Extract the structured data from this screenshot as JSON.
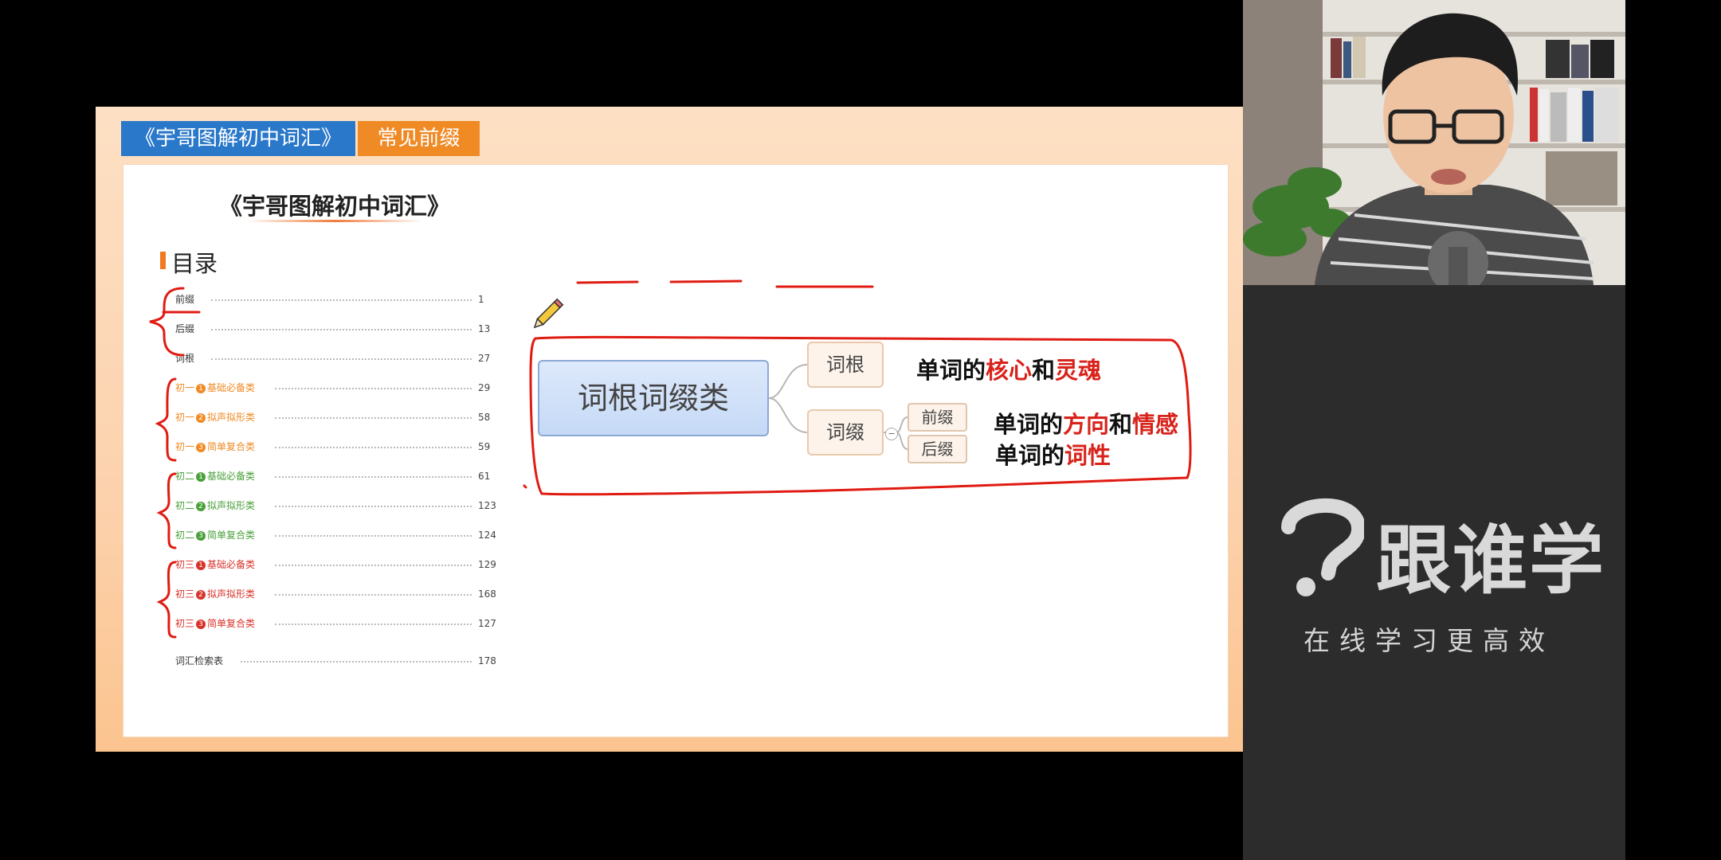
{
  "slide": {
    "tab_book": "《宇哥图解初中词汇》",
    "tab_topic": "常见前缀",
    "book_title": "《宇哥图解初中词汇》",
    "toc_heading": "目录",
    "toc": [
      {
        "label": "前缀",
        "page": "1",
        "color": "black"
      },
      {
        "label": "后缀",
        "page": "13",
        "color": "black"
      },
      {
        "label": "词根",
        "page": "27",
        "color": "black"
      },
      {
        "grade": "初一",
        "num": "1",
        "label": "基础必备类",
        "page": "29",
        "color": "orange"
      },
      {
        "grade": "初一",
        "num": "2",
        "label": "拟声拟形类",
        "page": "58",
        "color": "orange"
      },
      {
        "grade": "初一",
        "num": "3",
        "label": "简单复合类",
        "page": "59",
        "color": "orange"
      },
      {
        "grade": "初二",
        "num": "1",
        "label": "基础必备类",
        "page": "61",
        "color": "green"
      },
      {
        "grade": "初二",
        "num": "2",
        "label": "拟声拟形类",
        "page": "123",
        "color": "green"
      },
      {
        "grade": "初二",
        "num": "3",
        "label": "简单复合类",
        "page": "124",
        "color": "green"
      },
      {
        "grade": "初三",
        "num": "1",
        "label": "基础必备类",
        "page": "129",
        "color": "red"
      },
      {
        "grade": "初三",
        "num": "2",
        "label": "拟声拟形类",
        "page": "168",
        "color": "red"
      },
      {
        "grade": "初三",
        "num": "3",
        "label": "简单复合类",
        "page": "127",
        "color": "red"
      },
      {
        "label": "词汇检索表",
        "page": "178",
        "color": "black"
      }
    ],
    "mindmap": {
      "main": "词根词缀类",
      "root": "词根",
      "affix": "词缀",
      "prefix": "前缀",
      "suffix": "后缀",
      "root_desc": {
        "a": "单词的",
        "b": "核心",
        "c": "和",
        "d": "灵魂"
      },
      "prefix_desc": {
        "a": "单词的",
        "b": "方向",
        "c": "和",
        "d": "情感"
      },
      "suffix_desc": {
        "a": "单词的",
        "b": "词性"
      },
      "collapse_symbol": "−"
    }
  },
  "brand": {
    "name": "跟谁学",
    "slogan": "在线学习更高效"
  },
  "colors": {
    "tab_book": "#2a78c9",
    "tab_topic": "#ef8a25",
    "annotation_red": "#e01b12",
    "brand_bg": "#2c2c2c"
  }
}
